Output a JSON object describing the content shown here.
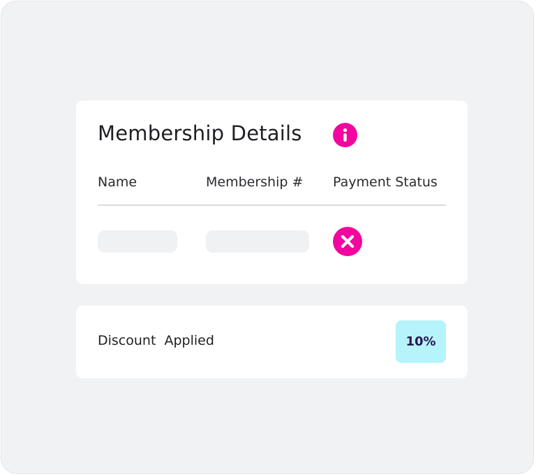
{
  "membership": {
    "title": "Membership Details",
    "info_icon": "info-icon",
    "columns": {
      "name": "Name",
      "membership_number": "Membership #",
      "payment_status": "Payment Status"
    },
    "row": {
      "payment_status_icon": "close-circle-icon"
    }
  },
  "discount": {
    "label": "Discount  Applied",
    "value": "10%"
  },
  "colors": {
    "accent": "#f2069f",
    "badge_bg": "#b6f4fb",
    "badge_text": "#2a1655",
    "frame_bg": "#f1f2f4",
    "placeholder": "#f0f1f3"
  }
}
